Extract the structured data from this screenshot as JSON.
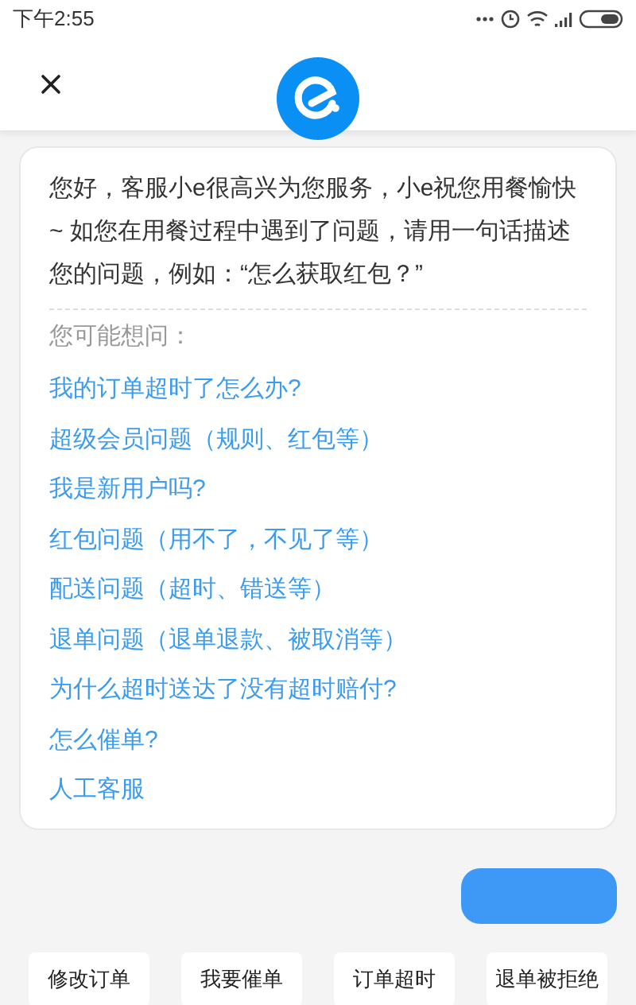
{
  "status_bar": {
    "time": "下午2:55"
  },
  "welcome": {
    "message": "您好，客服小e很高兴为您服务，小e祝您用餐愉快~ 如您在用餐过程中遇到了问题，请用一句话描述您的问题，例如：“怎么获取红包？”",
    "suggestions_title": "您可能想问：",
    "suggestions": [
      "我的订单超时了怎么办?",
      "超级会员问题（规则、红包等）",
      "我是新用户吗?",
      "红包问题（用不了，不见了等）",
      "配送问题（超时、错送等）",
      "退单问题（退单退款、被取消等）",
      "为什么超时送达了没有超时赔付?",
      "怎么催单?",
      "人工客服"
    ]
  },
  "quick_replies": [
    "修改订单",
    "我要催单",
    "订单超时",
    "退单被拒绝"
  ]
}
